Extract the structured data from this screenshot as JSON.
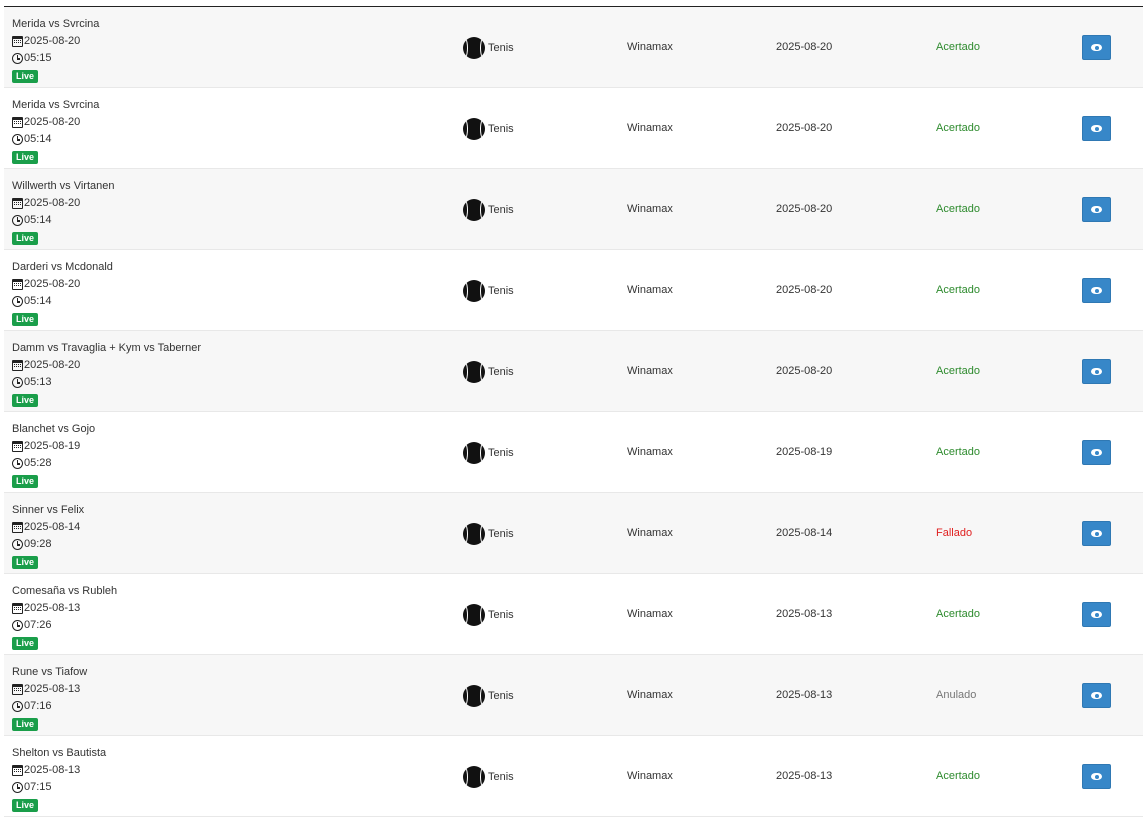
{
  "rows": [
    {
      "event": "Merida vs Svrcina",
      "date": "2025-08-20",
      "time": "05:15",
      "badge": "Live",
      "sport": "Tenis",
      "sport_icon": "tennis-ball-icon",
      "bookmaker": "Winamax",
      "settled_date": "2025-08-20",
      "result": "Acertado",
      "result_status": "ok"
    },
    {
      "event": "Merida vs Svrcina",
      "date": "2025-08-20",
      "time": "05:14",
      "badge": "Live",
      "sport": "Tenis",
      "sport_icon": "tennis-ball-icon",
      "bookmaker": "Winamax",
      "settled_date": "2025-08-20",
      "result": "Acertado",
      "result_status": "ok"
    },
    {
      "event": "Willwerth vs Virtanen",
      "date": "2025-08-20",
      "time": "05:14",
      "badge": "Live",
      "sport": "Tenis",
      "sport_icon": "tennis-ball-icon",
      "bookmaker": "Winamax",
      "settled_date": "2025-08-20",
      "result": "Acertado",
      "result_status": "ok"
    },
    {
      "event": "Darderi vs Mcdonald",
      "date": "2025-08-20",
      "time": "05:14",
      "badge": "Live",
      "sport": "Tenis",
      "sport_icon": "tennis-ball-icon",
      "bookmaker": "Winamax",
      "settled_date": "2025-08-20",
      "result": "Acertado",
      "result_status": "ok"
    },
    {
      "event": "Damm vs Travaglia + Kym vs Taberner",
      "date": "2025-08-20",
      "time": "05:13",
      "badge": "Live",
      "sport": "Tenis",
      "sport_icon": "tennis-ball-icon",
      "bookmaker": "Winamax",
      "settled_date": "2025-08-20",
      "result": "Acertado",
      "result_status": "ok"
    },
    {
      "event": "Blanchet vs Gojo",
      "date": "2025-08-19",
      "time": "05:28",
      "badge": "Live",
      "sport": "Tenis",
      "sport_icon": "tennis-ball-icon",
      "bookmaker": "Winamax",
      "settled_date": "2025-08-19",
      "result": "Acertado",
      "result_status": "ok"
    },
    {
      "event": "Sinner vs Felix",
      "date": "2025-08-14",
      "time": "09:28",
      "badge": "Live",
      "sport": "Tenis",
      "sport_icon": "tennis-ball-icon",
      "bookmaker": "Winamax",
      "settled_date": "2025-08-14",
      "result": "Fallado",
      "result_status": "fail"
    },
    {
      "event": "Comesaña vs Rubleh",
      "date": "2025-08-13",
      "time": "07:26",
      "badge": "Live",
      "sport": "Tenis",
      "sport_icon": "tennis-ball-icon",
      "bookmaker": "Winamax",
      "settled_date": "2025-08-13",
      "result": "Acertado",
      "result_status": "ok"
    },
    {
      "event": "Rune vs Tiafow",
      "date": "2025-08-13",
      "time": "07:16",
      "badge": "Live",
      "sport": "Tenis",
      "sport_icon": "tennis-ball-icon",
      "bookmaker": "Winamax",
      "settled_date": "2025-08-13",
      "result": "Anulado",
      "result_status": "void"
    },
    {
      "event": "Shelton vs Bautista",
      "date": "2025-08-13",
      "time": "07:15",
      "badge": "Live",
      "sport": "Tenis",
      "sport_icon": "tennis-ball-icon",
      "bookmaker": "Winamax",
      "settled_date": "2025-08-13",
      "result": "Acertado",
      "result_status": "ok"
    }
  ],
  "colors": {
    "ok": "#2e8b2e",
    "fail": "#e02020",
    "void": "#777777",
    "badge": "#1a9e4a",
    "view_button": "#3787c8"
  },
  "icons": {
    "date": "calendar-icon",
    "time": "clock-icon",
    "view": "eye-icon"
  }
}
